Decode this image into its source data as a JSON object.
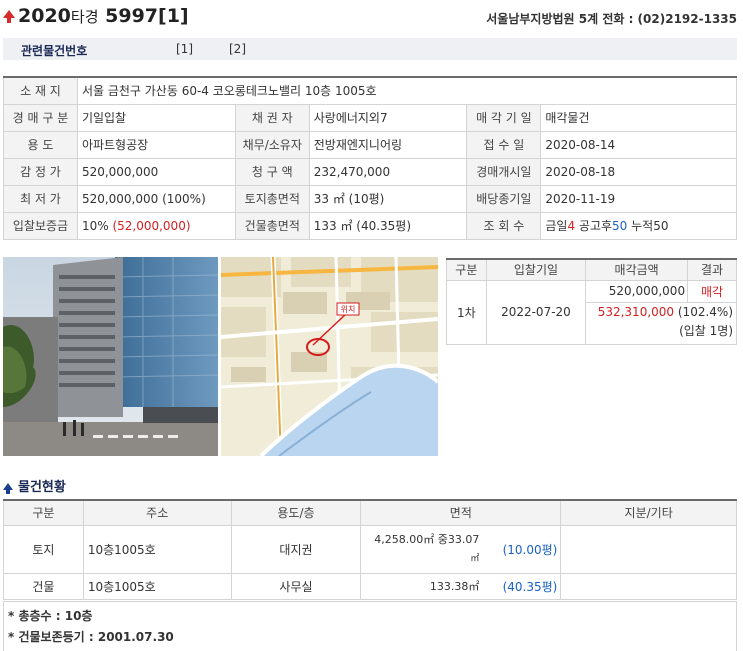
{
  "header": {
    "case_year": "2020",
    "case_type": "타경",
    "case_no": "5997[1]",
    "court": "서울남부지방법원 5계  전화 : (02)2192-1335"
  },
  "related": {
    "label": "관련물건번호",
    "items": [
      "[1]",
      "[2]"
    ]
  },
  "info": {
    "location_label": "소 재 지",
    "location_value": "서울 금천구 가산동 60-4 코오롱테크노밸리 10층 1005호",
    "auction_type_label": "경 매 구 분",
    "auction_type_value": "기일입찰",
    "creditor_label": "채 권 자",
    "creditor_value": "사랑에너지외7",
    "sale_target_label": "매 각 기 일",
    "sale_target_value": "매각물건",
    "usage_label": "용 도",
    "usage_value": "아파트형공장",
    "debtor_label": "채무/소유자",
    "debtor_value": "전방재엔지니어링",
    "received_label": "접 수 일",
    "received_value": "2020-08-14",
    "appraisal_label": "감 정 가",
    "appraisal_value": "520,000,000",
    "claim_label": "청 구 액",
    "claim_value": "232,470,000",
    "start_label": "경매개시일",
    "start_value": "2020-08-18",
    "min_label": "최 저 가",
    "min_value": "520,000,000 (100%)",
    "land_area_label": "토지총면적",
    "land_area_value": "33 ㎡ (10평)",
    "dividend_label": "배당종기일",
    "dividend_value": "2020-11-19",
    "deposit_label": "입찰보증금",
    "deposit_pct": "10%",
    "deposit_amount": "(52,000,000)",
    "bldg_area_label": "건물총면적",
    "bldg_area_value": "133 ㎡ (40.35평)",
    "views_label": "조 회 수",
    "views_today_label": "금일",
    "views_today": "4",
    "views_notice_label": "공고후",
    "views_notice": "50",
    "views_total_label": "누적",
    "views_total": "50"
  },
  "map": {
    "marker_label": "위치"
  },
  "bid_table": {
    "headers": [
      "구분",
      "입찰기일",
      "매각금액",
      "결과"
    ],
    "round": "1차",
    "date": "2022-07-20",
    "min_price": "520,000,000",
    "result": "매각",
    "sold_price": "532,310,000",
    "sold_pct": "(102.4%)",
    "bidders": "(입찰 1명)"
  },
  "section_title": "물건현황",
  "objects": {
    "headers": [
      "구분",
      "주소",
      "용도/층",
      "면적",
      "지분/기타"
    ],
    "rows": [
      {
        "kind": "토지",
        "addr": "10층1005호",
        "use": "대지권",
        "area": "4,258.00㎡ 중33.07",
        "area_unit": "㎡",
        "pyeong": "(10.00평)"
      },
      {
        "kind": "건물",
        "addr": "10층1005호",
        "use": "사무실",
        "area": "133.38㎡",
        "pyeong": "(40.35평)"
      }
    ]
  },
  "notes": [
    "* 총층수 : 10층",
    "* 건물보존등기 : 2001.07.30"
  ]
}
